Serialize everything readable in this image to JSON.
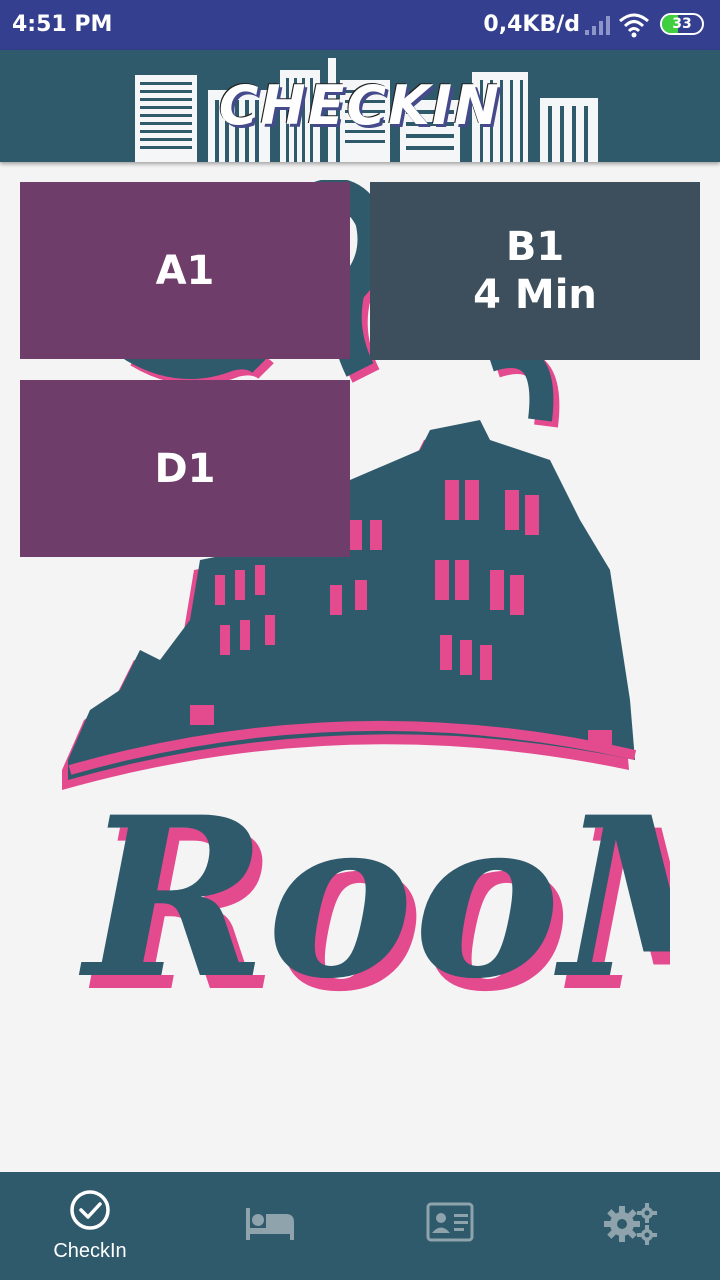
{
  "status_bar": {
    "time": "4:51 PM",
    "network_speed": "0,4KB/d",
    "battery_level": "33",
    "icons": [
      "signal-icon",
      "wifi-icon",
      "battery-icon"
    ]
  },
  "app_bar": {
    "title": "CHECKIN"
  },
  "tiles": [
    {
      "name": "A1",
      "sub": "",
      "color": "#6e3d69"
    },
    {
      "name": "B1",
      "sub": "4 Min",
      "color": "#3d4f5c"
    },
    {
      "name": "D1",
      "sub": "",
      "color": "#6e3d69"
    }
  ],
  "background_logo": {
    "text": "RooM"
  },
  "bottom_nav": {
    "items": [
      {
        "label": "CheckIn",
        "icon": "check-circle-icon",
        "active": true
      },
      {
        "label": "",
        "icon": "bed-icon",
        "active": false
      },
      {
        "label": "",
        "icon": "id-card-icon",
        "active": false
      },
      {
        "label": "",
        "icon": "gears-icon",
        "active": false
      }
    ]
  },
  "colors": {
    "status_bar": "#353f8f",
    "app_bar": "#2f5a6c",
    "tile_purple": "#6e3d69",
    "tile_slate": "#3d4f5c",
    "logo_teal": "#2f5a6c",
    "logo_pink": "#e44a8e"
  }
}
